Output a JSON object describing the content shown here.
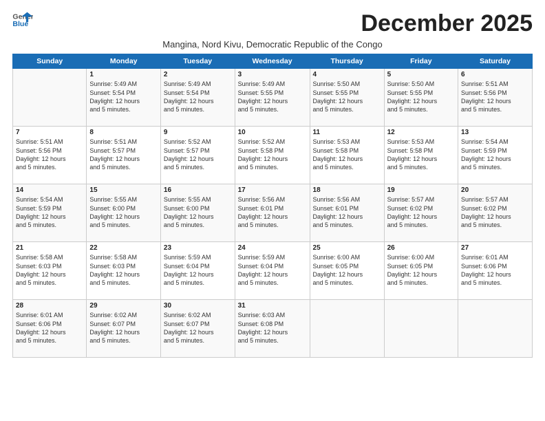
{
  "logo": {
    "line1": "General",
    "line2": "Blue"
  },
  "title": "December 2025",
  "subtitle": "Mangina, Nord Kivu, Democratic Republic of the Congo",
  "days_of_week": [
    "Sunday",
    "Monday",
    "Tuesday",
    "Wednesday",
    "Thursday",
    "Friday",
    "Saturday"
  ],
  "weeks": [
    [
      {
        "day": "",
        "info": ""
      },
      {
        "day": "1",
        "info": "Sunrise: 5:49 AM\nSunset: 5:54 PM\nDaylight: 12 hours\nand 5 minutes."
      },
      {
        "day": "2",
        "info": "Sunrise: 5:49 AM\nSunset: 5:54 PM\nDaylight: 12 hours\nand 5 minutes."
      },
      {
        "day": "3",
        "info": "Sunrise: 5:49 AM\nSunset: 5:55 PM\nDaylight: 12 hours\nand 5 minutes."
      },
      {
        "day": "4",
        "info": "Sunrise: 5:50 AM\nSunset: 5:55 PM\nDaylight: 12 hours\nand 5 minutes."
      },
      {
        "day": "5",
        "info": "Sunrise: 5:50 AM\nSunset: 5:55 PM\nDaylight: 12 hours\nand 5 minutes."
      },
      {
        "day": "6",
        "info": "Sunrise: 5:51 AM\nSunset: 5:56 PM\nDaylight: 12 hours\nand 5 minutes."
      }
    ],
    [
      {
        "day": "7",
        "info": "Sunrise: 5:51 AM\nSunset: 5:56 PM\nDaylight: 12 hours\nand 5 minutes."
      },
      {
        "day": "8",
        "info": "Sunrise: 5:51 AM\nSunset: 5:57 PM\nDaylight: 12 hours\nand 5 minutes."
      },
      {
        "day": "9",
        "info": "Sunrise: 5:52 AM\nSunset: 5:57 PM\nDaylight: 12 hours\nand 5 minutes."
      },
      {
        "day": "10",
        "info": "Sunrise: 5:52 AM\nSunset: 5:58 PM\nDaylight: 12 hours\nand 5 minutes."
      },
      {
        "day": "11",
        "info": "Sunrise: 5:53 AM\nSunset: 5:58 PM\nDaylight: 12 hours\nand 5 minutes."
      },
      {
        "day": "12",
        "info": "Sunrise: 5:53 AM\nSunset: 5:58 PM\nDaylight: 12 hours\nand 5 minutes."
      },
      {
        "day": "13",
        "info": "Sunrise: 5:54 AM\nSunset: 5:59 PM\nDaylight: 12 hours\nand 5 minutes."
      }
    ],
    [
      {
        "day": "14",
        "info": "Sunrise: 5:54 AM\nSunset: 5:59 PM\nDaylight: 12 hours\nand 5 minutes."
      },
      {
        "day": "15",
        "info": "Sunrise: 5:55 AM\nSunset: 6:00 PM\nDaylight: 12 hours\nand 5 minutes."
      },
      {
        "day": "16",
        "info": "Sunrise: 5:55 AM\nSunset: 6:00 PM\nDaylight: 12 hours\nand 5 minutes."
      },
      {
        "day": "17",
        "info": "Sunrise: 5:56 AM\nSunset: 6:01 PM\nDaylight: 12 hours\nand 5 minutes."
      },
      {
        "day": "18",
        "info": "Sunrise: 5:56 AM\nSunset: 6:01 PM\nDaylight: 12 hours\nand 5 minutes."
      },
      {
        "day": "19",
        "info": "Sunrise: 5:57 AM\nSunset: 6:02 PM\nDaylight: 12 hours\nand 5 minutes."
      },
      {
        "day": "20",
        "info": "Sunrise: 5:57 AM\nSunset: 6:02 PM\nDaylight: 12 hours\nand 5 minutes."
      }
    ],
    [
      {
        "day": "21",
        "info": "Sunrise: 5:58 AM\nSunset: 6:03 PM\nDaylight: 12 hours\nand 5 minutes."
      },
      {
        "day": "22",
        "info": "Sunrise: 5:58 AM\nSunset: 6:03 PM\nDaylight: 12 hours\nand 5 minutes."
      },
      {
        "day": "23",
        "info": "Sunrise: 5:59 AM\nSunset: 6:04 PM\nDaylight: 12 hours\nand 5 minutes."
      },
      {
        "day": "24",
        "info": "Sunrise: 5:59 AM\nSunset: 6:04 PM\nDaylight: 12 hours\nand 5 minutes."
      },
      {
        "day": "25",
        "info": "Sunrise: 6:00 AM\nSunset: 6:05 PM\nDaylight: 12 hours\nand 5 minutes."
      },
      {
        "day": "26",
        "info": "Sunrise: 6:00 AM\nSunset: 6:05 PM\nDaylight: 12 hours\nand 5 minutes."
      },
      {
        "day": "27",
        "info": "Sunrise: 6:01 AM\nSunset: 6:06 PM\nDaylight: 12 hours\nand 5 minutes."
      }
    ],
    [
      {
        "day": "28",
        "info": "Sunrise: 6:01 AM\nSunset: 6:06 PM\nDaylight: 12 hours\nand 5 minutes."
      },
      {
        "day": "29",
        "info": "Sunrise: 6:02 AM\nSunset: 6:07 PM\nDaylight: 12 hours\nand 5 minutes."
      },
      {
        "day": "30",
        "info": "Sunrise: 6:02 AM\nSunset: 6:07 PM\nDaylight: 12 hours\nand 5 minutes."
      },
      {
        "day": "31",
        "info": "Sunrise: 6:03 AM\nSunset: 6:08 PM\nDaylight: 12 hours\nand 5 minutes."
      },
      {
        "day": "",
        "info": ""
      },
      {
        "day": "",
        "info": ""
      },
      {
        "day": "",
        "info": ""
      }
    ]
  ]
}
